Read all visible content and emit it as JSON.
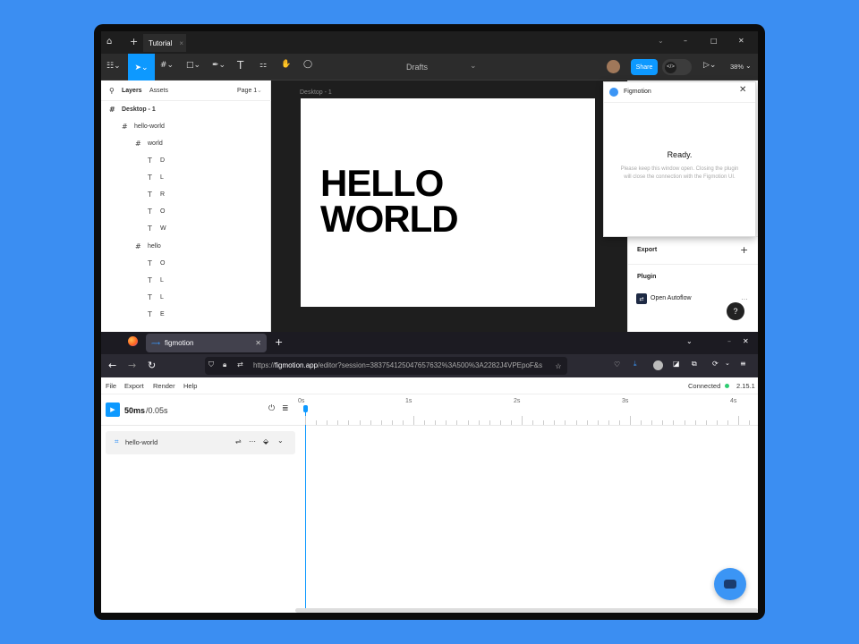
{
  "figma": {
    "tab_title": "Tutorial",
    "toolbar": {
      "drafts": "Drafts",
      "share": "Share",
      "zoom": "38%"
    },
    "left_panel": {
      "tabs": [
        "Layers",
        "Assets"
      ],
      "page": "Page 1",
      "layers": [
        {
          "name": "Desktop - 1",
          "icon": "#"
        },
        {
          "name": "hello-world",
          "icon": "#"
        },
        {
          "name": "world",
          "icon": "#"
        },
        {
          "name": "D",
          "icon": "T"
        },
        {
          "name": "L",
          "icon": "T"
        },
        {
          "name": "R",
          "icon": "T"
        },
        {
          "name": "O",
          "icon": "T"
        },
        {
          "name": "W",
          "icon": "T"
        },
        {
          "name": "hello",
          "icon": "#"
        },
        {
          "name": "O",
          "icon": "T"
        },
        {
          "name": "L",
          "icon": "T"
        },
        {
          "name": "L",
          "icon": "T"
        },
        {
          "name": "E",
          "icon": "T"
        }
      ]
    },
    "canvas": {
      "frame_label": "Desktop - 1",
      "headline": "HELLO\nWORLD"
    },
    "plugin_window": {
      "title": "Figmotion",
      "status": "Ready.",
      "message": "Please keep this window open. Closing the plugin will close the connection with the Figmotion UI."
    },
    "right_panel": {
      "export_label": "Export",
      "plugin_label": "Plugin",
      "plugin_item": "Open Autoflow",
      "help": "?"
    }
  },
  "firefox": {
    "tab_title": "figmotion",
    "url_prefix": "https://",
    "url_host": "figmotion.app",
    "url_rest": "/editor?session=38375412504765763​2%3A500%3A2282J4VPEpoF&s"
  },
  "figmotion": {
    "menu": [
      "File",
      "Export",
      "Render",
      "Help"
    ],
    "connection": "Connected",
    "version": "2.15.1",
    "time_current": "50ms",
    "time_seconds": "/0.05s",
    "ruler": [
      "0s",
      "1s",
      "2s",
      "3s",
      "4s"
    ],
    "layer_name": "hello-world"
  },
  "colors": {
    "accent": "#0d99ff",
    "connected": "#2ecc71",
    "chat": "#3b95f5"
  }
}
